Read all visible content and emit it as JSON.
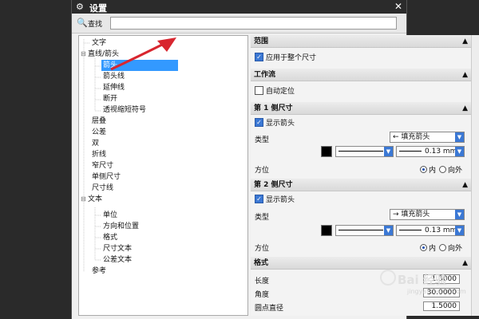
{
  "window": {
    "title": "设置"
  },
  "search": {
    "label": "查找",
    "value": ""
  },
  "tree": {
    "items": [
      {
        "label": "文字"
      },
      {
        "label": "直线/箭头"
      },
      {
        "label": "箭头"
      },
      {
        "label": "箭头线"
      },
      {
        "label": "延伸线"
      },
      {
        "label": "断开"
      },
      {
        "label": "透视缩短符号"
      },
      {
        "label": "层叠"
      },
      {
        "label": "公差"
      },
      {
        "label": "双"
      },
      {
        "label": "折线"
      },
      {
        "label": "窄尺寸"
      },
      {
        "label": "单侧尺寸"
      },
      {
        "label": "尺寸线"
      },
      {
        "label": "文本"
      },
      {
        "label": "单位"
      },
      {
        "label": "方向和位置"
      },
      {
        "label": "格式"
      },
      {
        "label": "尺寸文本"
      },
      {
        "label": "公差文本"
      },
      {
        "label": "参考"
      }
    ],
    "selected": "箭头"
  },
  "sections": {
    "scope": {
      "title": "范围",
      "apply_all_label": "应用于整个尺寸",
      "apply_all_checked": true
    },
    "workflow": {
      "title": "工作流",
      "auto_place_label": "自动定位",
      "auto_place_checked": false
    },
    "side1": {
      "title": "第 1 侧尺寸",
      "show_arrow_label": "显示箭头",
      "show_arrow_checked": true,
      "type_label": "类型",
      "type_value": "← 填充箭头",
      "line_width_value": "0.13 mm",
      "orientation_label": "方位",
      "radio_in": "内",
      "radio_out": "向外",
      "radio_selected": "内"
    },
    "side2": {
      "title": "第 2 侧尺寸",
      "show_arrow_label": "显示箭头",
      "show_arrow_checked": true,
      "type_label": "类型",
      "type_value": "→ 填充箭头",
      "line_width_value": "0.13 mm",
      "orientation_label": "方位",
      "radio_in": "内",
      "radio_out": "向外",
      "radio_selected": "内"
    },
    "format": {
      "title": "格式",
      "length_label": "长度",
      "length_value": "1.3000",
      "angle_label": "角度",
      "angle_value": "30.0000",
      "dot_label": "圆点直径",
      "dot_value": "1.5000"
    }
  },
  "watermark": {
    "text": "Bai 经验",
    "sub": "jingyan.baidu.com"
  },
  "colors": {
    "accent": "#3399ff",
    "titlebar": "#2b2b2b",
    "dropdown": "#3b78d4"
  }
}
